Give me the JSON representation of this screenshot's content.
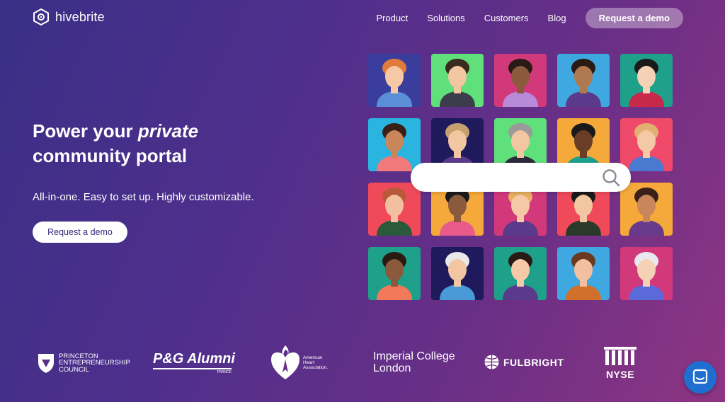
{
  "brand": {
    "name": "hivebrite"
  },
  "nav": {
    "links": [
      "Product",
      "Solutions",
      "Customers",
      "Blog"
    ],
    "cta": "Request a demo"
  },
  "hero": {
    "headline_part1": "Power your ",
    "headline_emph": "private",
    "headline_line2": "community portal",
    "subtitle": "All-in-one. Easy to set up. Highly customizable.",
    "cta": "Request a demo"
  },
  "logos": {
    "princeton": [
      "PRINCETON",
      "ENTREPRENEURSHIP",
      "COUNCIL"
    ],
    "pg": {
      "main": "P&G Alumni",
      "sub": "FRANCE"
    },
    "aha": [
      "American",
      "Heart",
      "Association."
    ],
    "imperial": [
      "Imperial College",
      "London"
    ],
    "fulbright": "FULBRIGHT",
    "nyse": "NYSE"
  },
  "avatars": [
    {
      "bg": "#3b3d9c",
      "skin": "#f5c9a6",
      "hair": "#e07b3a",
      "shirt": "#5a8fd8"
    },
    {
      "bg": "#5fe07a",
      "skin": "#f2c6a0",
      "hair": "#3a2a20",
      "shirt": "#3c3c4c"
    },
    {
      "bg": "#d2397a",
      "skin": "#8b5a3c",
      "hair": "#2a1a14",
      "shirt": "#b98ad8"
    },
    {
      "bg": "#3fa8e0",
      "skin": "#b07a50",
      "hair": "#2a1a14",
      "shirt": "#5a3a8a"
    },
    {
      "bg": "#1fa08a",
      "skin": "#f5d2b5",
      "hair": "#1a1a1a",
      "shirt": "#c8284a"
    },
    {
      "bg": "#2ab5e0",
      "skin": "#c8865a",
      "hair": "#3a2018",
      "shirt": "#f27a7a"
    },
    {
      "bg": "#1e1a5c",
      "skin": "#f2c6a0",
      "hair": "#c8a070",
      "shirt": "#5a3a8a"
    },
    {
      "bg": "#5fe07a",
      "skin": "#f2c6a0",
      "hair": "#9a9a9a",
      "shirt": "#2a2a3a"
    },
    {
      "bg": "#f5a93a",
      "skin": "#6a3e24",
      "hair": "#1a1a1a",
      "shirt": "#1fa08a"
    },
    {
      "bg": "#f04a6a",
      "skin": "#f5c9a6",
      "hair": "#e0b070",
      "shirt": "#4a7ad0"
    },
    {
      "bg": "#f04a5a",
      "skin": "#f2c0a0",
      "hair": "#b85a3a",
      "shirt": "#2a5a3a"
    },
    {
      "bg": "#f5a93a",
      "skin": "#8b5a3c",
      "hair": "#1a1a1a",
      "shirt": "#e85a8a"
    },
    {
      "bg": "#d2397a",
      "skin": "#f5c9a6",
      "hair": "#e8b060",
      "shirt": "#5a3a8a"
    },
    {
      "bg": "#f04a5a",
      "skin": "#f2c6a0",
      "hair": "#1a1a1a",
      "shirt": "#2a3a2a"
    },
    {
      "bg": "#f5a93a",
      "skin": "#c8865a",
      "hair": "#3a2018",
      "shirt": "#6a3a8a"
    },
    {
      "bg": "#1fa08a",
      "skin": "#8b5a3c",
      "hair": "#2a1a14",
      "shirt": "#f27a5a"
    },
    {
      "bg": "#1e1a5c",
      "skin": "#f2c6a0",
      "hair": "#e8e8e8",
      "shirt": "#4a9ad8"
    },
    {
      "bg": "#1fa08a",
      "skin": "#f5c9a6",
      "hair": "#2a1a14",
      "shirt": "#5a3a8a"
    },
    {
      "bg": "#3fa8e0",
      "skin": "#f2c0a0",
      "hair": "#6a3a20",
      "shirt": "#d0702a"
    },
    {
      "bg": "#d2397a",
      "skin": "#f5d2b5",
      "hair": "#e8e8f0",
      "shirt": "#5a6ad8"
    }
  ],
  "colors": {
    "chat_button": "#1f6fd0",
    "cta_text": "#3b2a7a"
  }
}
